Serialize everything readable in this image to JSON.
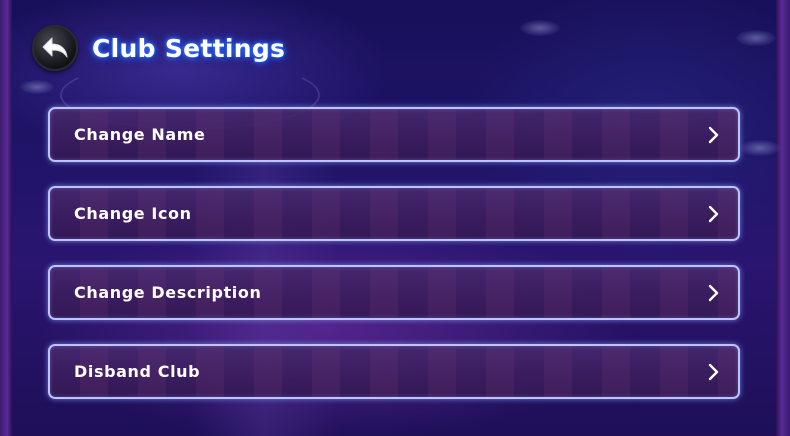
{
  "header": {
    "title": "Club Settings",
    "back_icon": "back-arrow-icon"
  },
  "menu": {
    "items": [
      {
        "label": "Change Name",
        "icon": "chevron-right-icon"
      },
      {
        "label": "Change Icon",
        "icon": "chevron-right-icon"
      },
      {
        "label": "Change Description",
        "icon": "chevron-right-icon"
      },
      {
        "label": "Disband Club",
        "icon": "chevron-right-icon"
      }
    ]
  },
  "colors": {
    "title_glow": "#2f6bff",
    "row_border": "#b9c6ff",
    "background": "#1f1468"
  }
}
